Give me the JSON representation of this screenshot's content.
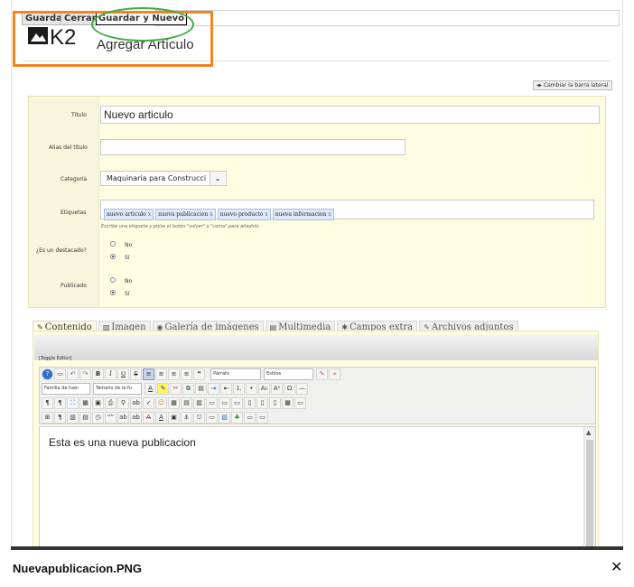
{
  "toolbar": {
    "save": "Guardar",
    "close": "Cerrar",
    "save_new": "Guardar y Nuevo"
  },
  "brand": {
    "logo_text": "K2"
  },
  "page": {
    "title": "Agregar Artículo",
    "sidebar_toggle": "Cambiar la barra lateral"
  },
  "form": {
    "title_label": "Título",
    "title_value": "Nuevo articulo",
    "alias_label": "Alias del título",
    "alias_value": "",
    "category_label": "Categoría",
    "category_value": "Maquinaria para Construcci",
    "tags_label": "Etiquetas",
    "tags": [
      "nuevo articulo",
      "nueva publicacion",
      "nuevo producto",
      "nueva informacion"
    ],
    "tag_remove": "x",
    "tags_help": "Escribe una etiqueta y pulse el botón \"volver\" o \"coma\" para añadirlo.",
    "featured_label": "¿Es un destacado?",
    "published_label": "Publicado",
    "no": "No",
    "yes": "Sí"
  },
  "tabs": [
    {
      "label": "Contenido",
      "icon": "edit-icon"
    },
    {
      "label": "Imagen",
      "icon": "image-icon"
    },
    {
      "label": "Galería de imágenes",
      "icon": "camera-icon"
    },
    {
      "label": "Multimedia",
      "icon": "film-icon"
    },
    {
      "label": "Campos extra",
      "icon": "star-icon"
    },
    {
      "label": "Archivos adjuntos",
      "icon": "paperclip-icon"
    }
  ],
  "editor": {
    "toggle": "[Toggle Editor]",
    "format_select": "Párrafo",
    "styles_select": "Estilos",
    "font_family_select": "Familia de fuen",
    "font_size_select": "Tamaño de la fu",
    "content": "Esta es una nueva publicacion"
  },
  "viewer": {
    "filename": "Nuevapublicacion.PNG",
    "close": "✕"
  },
  "colors": {
    "highlight_orange": "#f08524",
    "highlight_green": "#3eaa3e",
    "form_bg": "#fefde2"
  }
}
